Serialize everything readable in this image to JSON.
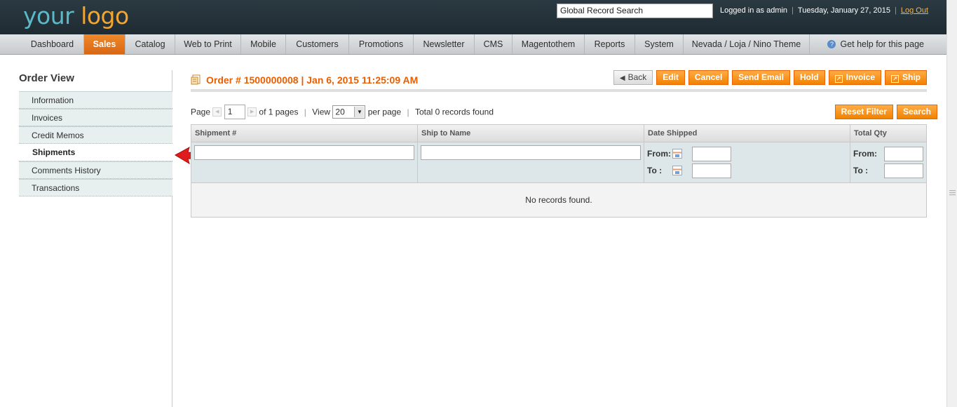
{
  "header": {
    "logo_part1": "your ",
    "logo_part2": "logo",
    "search_placeholder": "Global Record Search",
    "logged_in": "Logged in as admin",
    "date": "Tuesday, January 27, 2015",
    "logout": "Log Out"
  },
  "nav": {
    "items": [
      "Dashboard",
      "Sales",
      "Catalog",
      "Web to Print",
      "Mobile",
      "Customers",
      "Promotions",
      "Newsletter",
      "CMS",
      "Magentothem",
      "Reports",
      "System",
      "Nevada / Loja / Nino Theme"
    ],
    "active": "Sales",
    "help": "Get help for this page"
  },
  "sidebar": {
    "title": "Order View",
    "items": [
      "Information",
      "Invoices",
      "Credit Memos",
      "Shipments",
      "Comments History",
      "Transactions"
    ],
    "active": "Shipments"
  },
  "order": {
    "title": "Order # 1500000008 | Jan 6, 2015 11:25:09 AM",
    "buttons": {
      "back": "Back",
      "edit": "Edit",
      "cancel": "Cancel",
      "send_email": "Send Email",
      "hold": "Hold",
      "invoice": "Invoice",
      "ship": "Ship"
    }
  },
  "pager": {
    "page_label": "Page",
    "page_value": "1",
    "of_pages": "of 1 pages",
    "view_label": "View",
    "view_value": "20",
    "per_page": "per page",
    "total": "Total 0 records found"
  },
  "filters": {
    "reset": "Reset Filter",
    "search": "Search"
  },
  "grid": {
    "columns": [
      "Shipment #",
      "Ship to Name",
      "Date Shipped",
      "Total Qty"
    ],
    "from_label": "From:",
    "to_label": "To :",
    "empty": "No records found."
  },
  "colors": {
    "accent": "#eb5e00",
    "header_bg": "#24333a",
    "active_nav": "#e8761d"
  }
}
